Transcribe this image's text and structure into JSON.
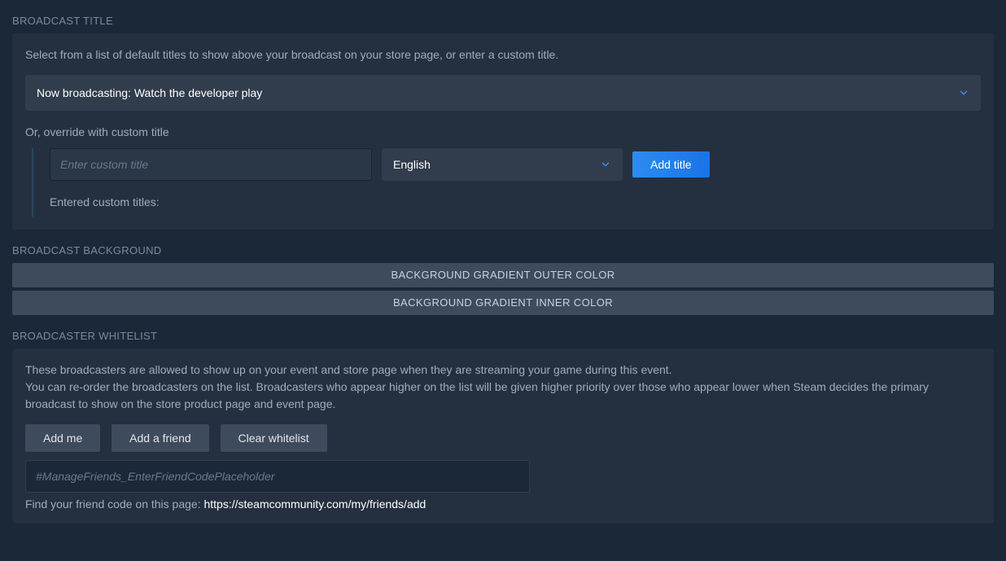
{
  "broadcast_title": {
    "section_label": "BROADCAST TITLE",
    "description": "Select from a list of default titles to show above your broadcast on your store page, or enter a custom title.",
    "default_select_value": "Now broadcasting: Watch the developer play",
    "override_label": "Or, override with custom title",
    "custom_title_placeholder": "Enter custom title",
    "language_select_value": "English",
    "add_title_button": "Add title",
    "entered_titles_label": "Entered custom titles:"
  },
  "broadcast_background": {
    "section_label": "BROADCAST BACKGROUND",
    "outer_color_label": "BACKGROUND GRADIENT OUTER COLOR",
    "inner_color_label": "BACKGROUND GRADIENT INNER COLOR"
  },
  "whitelist": {
    "section_label": "BROADCASTER WHITELIST",
    "description_line1": "These broadcasters are allowed to show up on your event and store page when they are streaming your game during this event.",
    "description_line2": "You can re-order the broadcasters on the list. Broadcasters who appear higher on the list will be given higher priority over those who appear lower when Steam decides the primary broadcast to show on the store product page and event page.",
    "add_me_button": "Add me",
    "add_friend_button": "Add a friend",
    "clear_whitelist_button": "Clear whitelist",
    "friend_code_placeholder": "#ManageFriends_EnterFriendCodePlaceholder",
    "friend_code_hint_prefix": "Find your friend code on this page: ",
    "friend_code_link": "https://steamcommunity.com/my/friends/add"
  }
}
